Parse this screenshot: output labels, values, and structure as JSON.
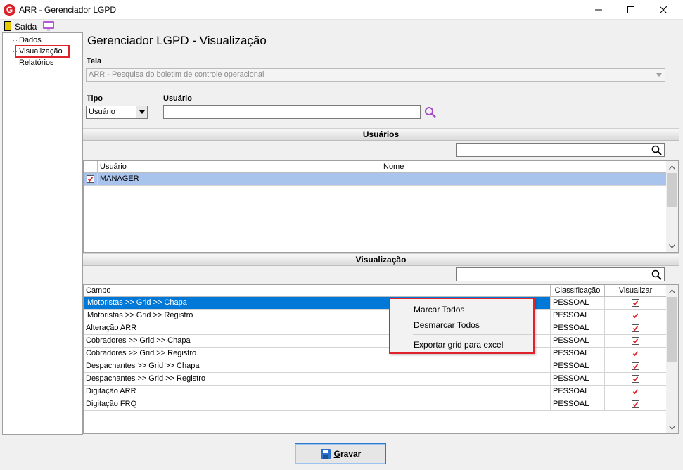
{
  "window": {
    "title": "ARR - Gerenciador LGPD",
    "logo_letter": "G"
  },
  "menu": {
    "exit_label": "Saída"
  },
  "tree": {
    "items": [
      "Dados",
      "Visualização",
      "Relatórios"
    ]
  },
  "page": {
    "title": "Gerenciador LGPD - Visualização"
  },
  "form": {
    "tela_label": "Tela",
    "tela_value": "ARR - Pesquisa do boletim de controle operacional",
    "tipo_label": "Tipo",
    "tipo_value": "Usuário",
    "usuario_label": "Usuário",
    "usuario_value": ""
  },
  "usuarios": {
    "section_title": "Usuários",
    "search_value": "",
    "columns": [
      "Usuário",
      "Nome"
    ],
    "rows": [
      {
        "usuario": "MANAGER",
        "nome": "",
        "checked": true
      }
    ]
  },
  "visualizacao": {
    "section_title": "Visualização",
    "search_value": "",
    "columns": [
      "Campo",
      "Classificação",
      "Visualizar"
    ],
    "rows": [
      {
        "campo": "Motoristas >> Grid >> Chapa",
        "classificacao": "PESSOAL",
        "visualizar": true
      },
      {
        "campo": "Motoristas >> Grid >> Registro",
        "classificacao": "PESSOAL",
        "visualizar": true
      },
      {
        "campo": "Alteração ARR",
        "classificacao": "PESSOAL",
        "visualizar": true
      },
      {
        "campo": "Cobradores >> Grid >> Chapa",
        "classificacao": "PESSOAL",
        "visualizar": true
      },
      {
        "campo": "Cobradores >> Grid >> Registro",
        "classificacao": "PESSOAL",
        "visualizar": true
      },
      {
        "campo": "Despachantes >> Grid >> Chapa",
        "classificacao": "PESSOAL",
        "visualizar": true
      },
      {
        "campo": "Despachantes >> Grid >> Registro",
        "classificacao": "PESSOAL",
        "visualizar": true
      },
      {
        "campo": "Digitação ARR",
        "classificacao": "PESSOAL",
        "visualizar": true
      },
      {
        "campo": "Digitação FRQ",
        "classificacao": "PESSOAL",
        "visualizar": true
      }
    ]
  },
  "context_menu": {
    "items": [
      "Marcar Todos",
      "Desmarcar Todos",
      "Exportar grid para excel"
    ]
  },
  "buttons": {
    "save_label": "Gravar",
    "save_mnemonic": "G",
    "save_rest": "ravar"
  },
  "colors": {
    "selection": "#0078d7",
    "row_selected": "#a8c4ec",
    "highlight_border": "#e0232a",
    "check_red": "#e0232a"
  }
}
